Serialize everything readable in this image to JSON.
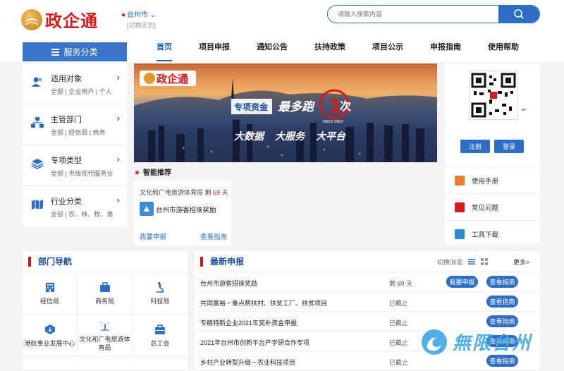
{
  "header": {
    "logo_text": "政企通",
    "city": "台州市",
    "city_switch": "[切换区划]",
    "search_placeholder": "请输入搜索内容"
  },
  "nav": {
    "category_label": "服务分类",
    "items": [
      "首页",
      "项目申报",
      "通知公告",
      "扶持政策",
      "项目公示",
      "申报指南",
      "使用帮助"
    ],
    "active": "首页"
  },
  "sidebar": {
    "items": [
      {
        "title": "适用对象",
        "sub": "全部 | 企业用户 | 个人",
        "icon": "users-icon"
      },
      {
        "title": "主管部门",
        "sub": "全部 | 经信局 | 商务",
        "icon": "org-chart-icon"
      },
      {
        "title": "专项类型",
        "sub": "全部 | 市级现代服务业",
        "icon": "layers-icon"
      },
      {
        "title": "行业分类",
        "sub": "全部 | 农、林、牧、渔",
        "icon": "map-icon"
      }
    ]
  },
  "banner": {
    "logo_text": "政企通",
    "slogan_a": "专项资金",
    "slogan_b": "最多跑",
    "slogan_c": "次",
    "slogan_tag": "ONCE ONLY",
    "sub": [
      "大数据",
      "大服务",
      "大平台"
    ]
  },
  "recommend": {
    "title": "智能推荐",
    "card": {
      "org": "文化和广电旅游体育局",
      "remain_prefix": "剩",
      "remain_days": "69",
      "remain_suffix": "天",
      "project": "台州市游客招徕奖励",
      "apply": "我要申报",
      "guide": "查看指南"
    }
  },
  "right_panel": {
    "register": "注册",
    "login": "登录",
    "links": [
      {
        "label": "使用手册",
        "icon": "manual-icon",
        "color": "#f07a2a"
      },
      {
        "label": "常见问题",
        "icon": "faq-icon",
        "color": "#d7191d"
      },
      {
        "label": "工具下载",
        "icon": "tools-icon",
        "color": "#2d8ad6"
      }
    ]
  },
  "departments": {
    "title": "部门导航",
    "items": [
      {
        "label": "经信局",
        "icon": "building-icon"
      },
      {
        "label": "商务局",
        "icon": "briefcase-icon"
      },
      {
        "label": "科技局",
        "icon": "microscope-icon"
      },
      {
        "label": "港航事业发展中心",
        "icon": "anchor-badge-icon"
      },
      {
        "label": "文化和广电旅游体育局",
        "icon": "palm-tree-icon"
      },
      {
        "label": "总工会",
        "icon": "toolbox-icon"
      }
    ]
  },
  "latest": {
    "title": "最新申报",
    "switch_label": "切换浏览:",
    "more": "更多>",
    "rows": [
      {
        "name": "台州市游客招徕奖励",
        "status_prefix": "剩",
        "days": "69",
        "status_suffix": "天",
        "apply": "我要申报",
        "guide": "查看指南"
      },
      {
        "name": "共同富裕－重点帮扶村、扶贫工厂、扶贫项目",
        "status": "已截止",
        "guide": "查看指南"
      },
      {
        "name": "专精特新企业2021年奖补资金申报",
        "status": "已截止",
        "guide": "查看指南"
      },
      {
        "name": "2021年台州市创新平台产学研合作专项",
        "status": "已截止",
        "guide": "查看指南"
      },
      {
        "name": "乡村产业转型升级－农业科技项目",
        "status": "已截止",
        "guide": "查看指南"
      }
    ]
  },
  "watermark": "無限台州"
}
